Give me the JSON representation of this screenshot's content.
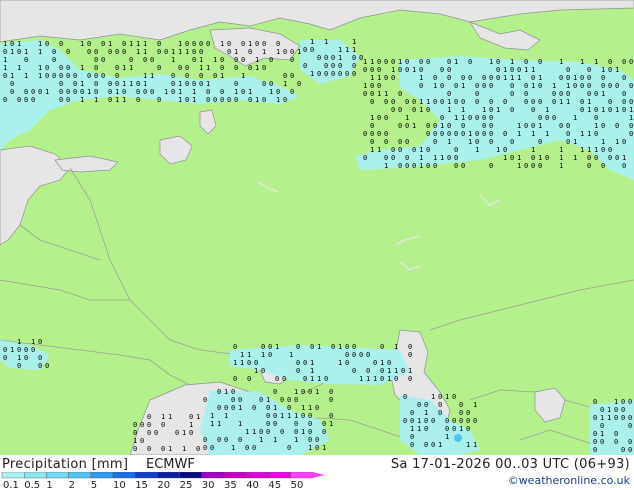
{
  "title": "Precipitation [mm]",
  "model": "ECMWF",
  "datetime": "Sa 17-01-2026 00..03 UTC (06+93)",
  "credit": "©weatheronline.co.uk",
  "legend": {
    "labels": [
      "0.1",
      "0.5",
      "1",
      "2",
      "5",
      "10",
      "15",
      "20",
      "25",
      "30",
      "35",
      "40",
      "45",
      "50"
    ],
    "colors": [
      "#aaf0f0",
      "#8ee6f0",
      "#72d8f4",
      "#50c4f4",
      "#2e9cf0",
      "#1c6ee8",
      "#1440c8",
      "#0c20a0",
      "#0a0a80",
      "#a000c8",
      "#c800c8",
      "#e000d8",
      "#f000e8",
      "#ff40ff"
    ]
  },
  "map_colors": {
    "land": "#b4f08c",
    "sea": "#e6e6e6",
    "precip": "#aaf0f0",
    "border": "#9aa09a",
    "coast": "#909090"
  }
}
